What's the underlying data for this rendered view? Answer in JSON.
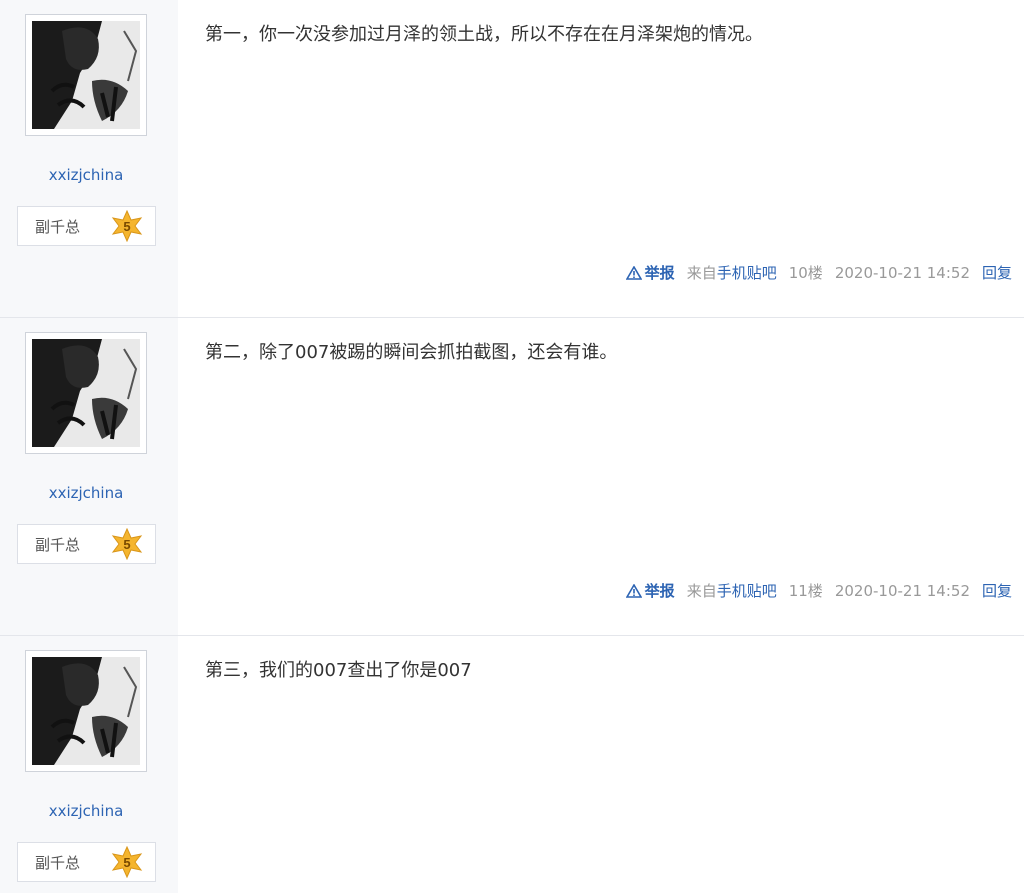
{
  "posts": [
    {
      "username": "xxizjchina",
      "level_title": "副千总",
      "level_num": "5",
      "text": "第一，你一次没参加过月泽的领土战，所以不存在在月泽架炮的情况。",
      "report_label": "举报",
      "source_prefix": "来自",
      "source_link": "手机贴吧",
      "floor": "10楼",
      "time": "2020-10-21 14:52",
      "reply_label": "回复"
    },
    {
      "username": "xxizjchina",
      "level_title": "副千总",
      "level_num": "5",
      "text": "第二，除了007被踢的瞬间会抓拍截图，还会有谁。",
      "report_label": "举报",
      "source_prefix": "来自",
      "source_link": "手机贴吧",
      "floor": "11楼",
      "time": "2020-10-21 14:52",
      "reply_label": "回复"
    },
    {
      "username": "xxizjchina",
      "level_title": "副千总",
      "level_num": "5",
      "text": "第三，我们的007查出了你是007"
    }
  ],
  "colors": {
    "link": "#2d64b3",
    "meta": "#999999",
    "sidebar_bg": "#f7f8fa",
    "star": "#f5b52e"
  },
  "icons": {
    "report": "warning-triangle-icon",
    "level": "level-star-icon"
  }
}
